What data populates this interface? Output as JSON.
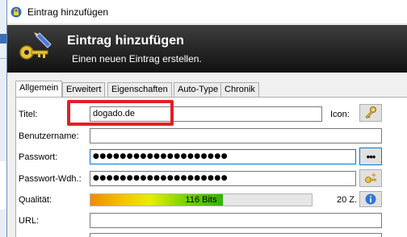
{
  "window": {
    "title": "Eintrag hinzufügen"
  },
  "banner": {
    "title": "Eintrag hinzufügen",
    "subtitle": "Einen neuen Eintrag erstellen."
  },
  "tabs": [
    {
      "label": "Allgemein",
      "active": true
    },
    {
      "label": "Erweitert",
      "active": false
    },
    {
      "label": "Eigenschaften",
      "active": false
    },
    {
      "label": "Auto-Type",
      "active": false
    },
    {
      "label": "Chronik",
      "active": false
    }
  ],
  "form": {
    "title_label": "Titel:",
    "title_value": "dogado.de",
    "icon_label": "Icon:",
    "username_label": "Benutzername:",
    "username_value": "",
    "password_label": "Passwort:",
    "password_value": "●●●●●●●●●●●●●●●●●●●●",
    "password_repeat_label": "Passwort-Wdh.:",
    "password_repeat_value": "●●●●●●●●●●●●●●●●●●●●",
    "show_password_glyph": "•••",
    "quality_label": "Qualität:",
    "quality_text": "116 Bits",
    "quality_fraction": 0.6,
    "char_count": "20 Z.",
    "url_label": "URL:",
    "url_value": ""
  },
  "colors": {
    "highlight": "#e0202a",
    "focus": "#0078d7",
    "banner": "#252525"
  },
  "icons": [
    "lock-icon",
    "keys-pen-icon",
    "key-icon",
    "show-password-icon",
    "generate-password-icon",
    "info-icon"
  ]
}
